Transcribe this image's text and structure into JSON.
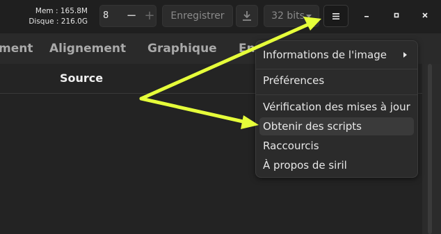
{
  "header": {
    "mem_label": "Mem : 165.8M",
    "disk_label": "Disque : 216.0G",
    "spin_value": "8",
    "spin_minus": "−",
    "spin_plus": "+",
    "save_label": "Enregistrer",
    "bits_label": "32 bits",
    "menu_icon": "hamburger-menu-icon",
    "download_icon": "download-icon",
    "minimize_icon": "minimize-icon",
    "maximize_icon": "maximize-icon",
    "close_icon": "close-icon"
  },
  "tabs": [
    {
      "label": "ment"
    },
    {
      "label": "Alignement"
    },
    {
      "label": "Graphique"
    },
    {
      "label": "En"
    }
  ],
  "panel": {
    "source_label": "Source"
  },
  "menu": {
    "items": [
      {
        "label": "Informations de l'image",
        "has_submenu": true
      },
      {
        "label": "Préférences"
      },
      {
        "label": "Vérification des mises à jour"
      },
      {
        "label": "Obtenir des scripts",
        "highlighted": true
      },
      {
        "label": "Raccourcis"
      },
      {
        "label": "À propos de siril"
      }
    ]
  },
  "colors": {
    "annotation_arrow": "#e6ff3a",
    "background": "#232323",
    "header": "#1f1f1f"
  }
}
